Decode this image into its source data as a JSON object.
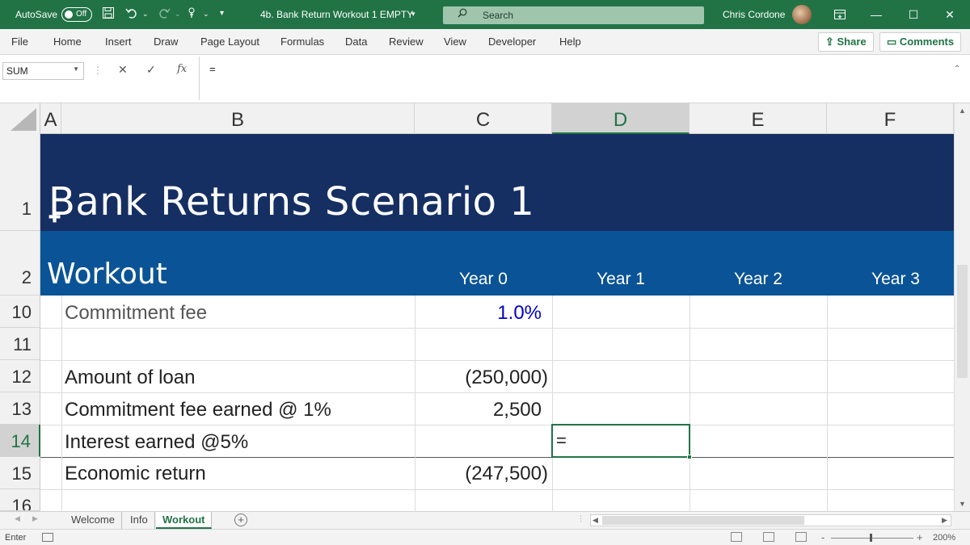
{
  "titlebar": {
    "autosave_label": "AutoSave",
    "autosave_state": "Off",
    "document_title": "4b. Bank Return Workout 1 EMPTY",
    "search_label": "Search",
    "user_name": "Chris Cordone"
  },
  "ribbon": {
    "tabs": [
      "File",
      "Home",
      "Insert",
      "Draw",
      "Page Layout",
      "Formulas",
      "Data",
      "Review",
      "View",
      "Developer",
      "Help"
    ],
    "share_label": "Share",
    "comments_label": "Comments"
  },
  "formula_bar": {
    "name_box": "SUM",
    "fx_label": "fx",
    "formula": "="
  },
  "columns": [
    "A",
    "B",
    "C",
    "D",
    "E",
    "F"
  ],
  "active_column": "D",
  "rows": {
    "r1": "1",
    "r2": "2",
    "r10": "10",
    "r11": "11",
    "r12": "12",
    "r13": "13",
    "r14": "14",
    "r15": "15",
    "r16": "16"
  },
  "sheet": {
    "title": "Bank Returns Scenario 1",
    "subtitle": "Workout",
    "years": [
      "Year 0",
      "Year 1",
      "Year 2",
      "Year 3"
    ],
    "commitment_fee_label": "Commitment fee",
    "commitment_fee_value": "1.0%",
    "amount_of_loan_label": "Amount of loan",
    "amount_of_loan_value": "(250,000)",
    "fee_earned_label": "Commitment fee earned @ 1%",
    "fee_earned_value": "2,500",
    "interest_label": "Interest earned @5%",
    "active_cell_value": "=",
    "economic_return_label": "Economic return",
    "economic_return_value": "(247,500)"
  },
  "sheet_tabs": [
    "Welcome",
    "Info",
    "Workout"
  ],
  "active_sheet": "Workout",
  "status": {
    "mode": "Enter",
    "zoom_minus": "-",
    "zoom_plus": "+",
    "zoom": "200%"
  },
  "colors": {
    "excel_green": "#217346",
    "title_band": "#162f62",
    "header_band": "#0a5396",
    "input_blue": "#0000cc"
  }
}
